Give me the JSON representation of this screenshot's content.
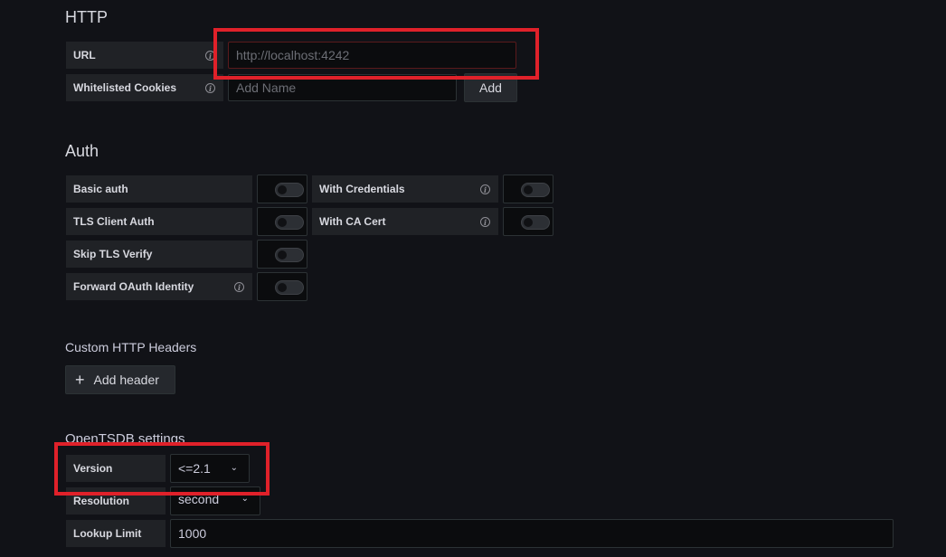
{
  "http": {
    "title": "HTTP",
    "url_label": "URL",
    "url_placeholder": "http://localhost:4242",
    "cookies_label": "Whitelisted Cookies",
    "cookies_placeholder": "Add Name",
    "add_button": "Add"
  },
  "auth": {
    "title": "Auth",
    "basic_auth": "Basic auth",
    "tls_client_auth": "TLS Client Auth",
    "skip_tls_verify": "Skip TLS Verify",
    "forward_oauth": "Forward OAuth Identity",
    "with_credentials": "With Credentials",
    "with_ca_cert": "With CA Cert"
  },
  "headers": {
    "title": "Custom HTTP Headers",
    "add_header_button": "Add header",
    "plus_glyph": "+"
  },
  "opentsdb": {
    "title": "OpenTSDB settings",
    "version_label": "Version",
    "version_value": "<=2.1",
    "resolution_label": "Resolution",
    "resolution_value": "second",
    "lookup_label": "Lookup Limit",
    "lookup_value": "1000"
  },
  "icons": {
    "info": "i",
    "chevron": "⌄"
  },
  "colors": {
    "background": "#111217",
    "highlight": "#e0212a"
  }
}
